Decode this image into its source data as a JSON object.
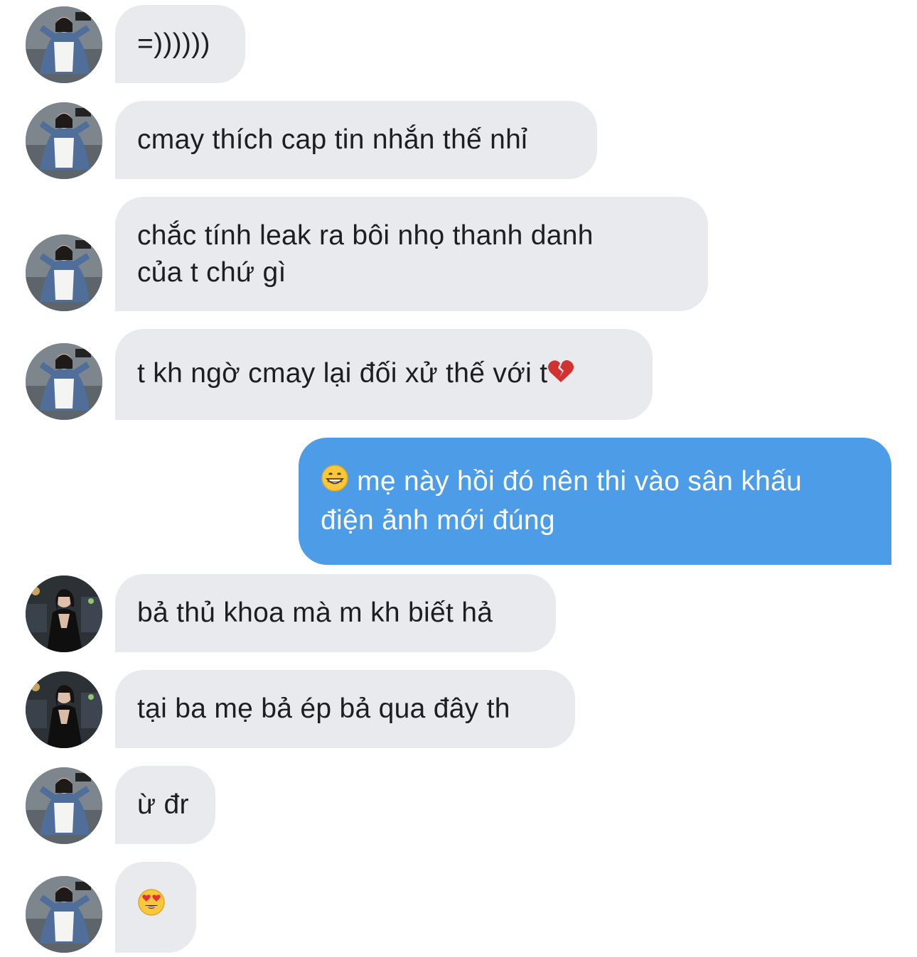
{
  "conversation": {
    "messages": [
      {
        "direction": "incoming",
        "avatar": "avatar-denim-jacket",
        "lines": [
          "=))))))"
        ]
      },
      {
        "direction": "incoming",
        "avatar": "avatar-denim-jacket",
        "lines": [
          "cmay thích cap tin nhắn thế nhỉ"
        ]
      },
      {
        "direction": "incoming",
        "avatar": "avatar-denim-jacket",
        "lines": [
          "chắc tính leak ra bôi nhọ thanh danh",
          "của t chứ gì"
        ]
      },
      {
        "direction": "incoming",
        "avatar": "avatar-denim-jacket",
        "lines": [
          "t kh ngờ cmay lại đối xử thế với t"
        ],
        "trailing_emoji": "broken-heart-icon"
      },
      {
        "direction": "outgoing",
        "lines": [
          "mẹ này hồi đó nên thi vào sân khấu",
          "điện ảnh mới đúng"
        ],
        "leading_emoji": "grinning-face-icon"
      },
      {
        "direction": "incoming",
        "avatar": "avatar-black-dress",
        "lines": [
          "bả thủ khoa mà m kh biết hả"
        ]
      },
      {
        "direction": "incoming",
        "avatar": "avatar-black-dress",
        "lines": [
          "tại ba mẹ bả ép bả qua đây th"
        ]
      },
      {
        "direction": "incoming",
        "avatar": "avatar-denim-jacket",
        "lines": [
          "ừ đr"
        ]
      },
      {
        "direction": "incoming",
        "avatar": "avatar-denim-jacket",
        "lines": [],
        "emoji_only": "heart-eyes-face-icon"
      }
    ]
  },
  "colors": {
    "incoming_bubble": "#e8eaee",
    "outgoing_bubble": "#4c9ce8",
    "incoming_text": "#1c1e21",
    "outgoing_text": "#ffffff"
  }
}
